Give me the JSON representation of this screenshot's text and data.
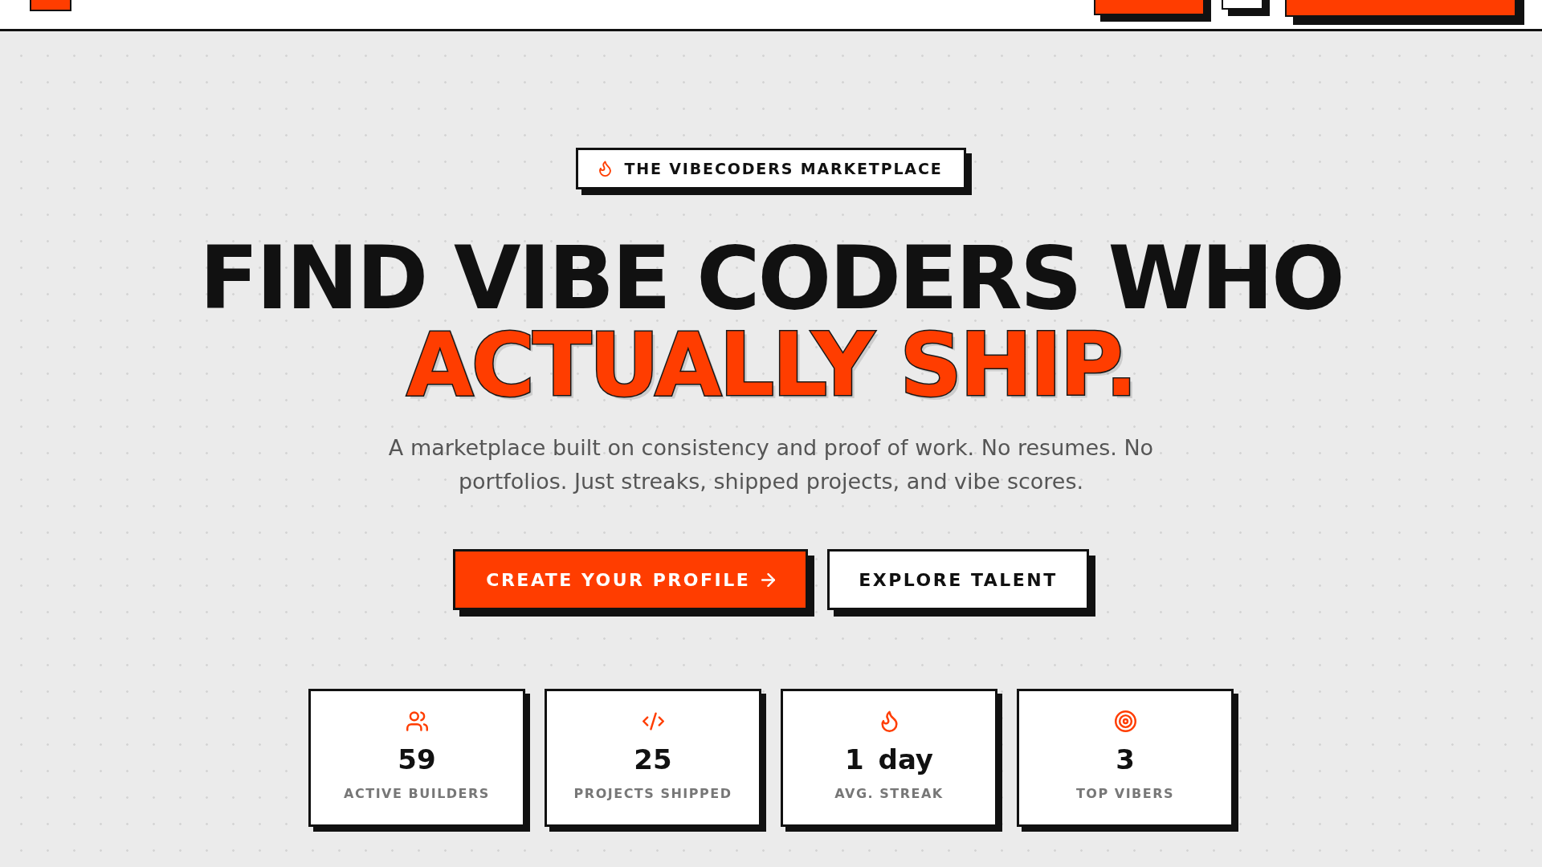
{
  "header": {
    "buttons": [
      {
        "kind": "primary"
      },
      {
        "kind": "secondary"
      },
      {
        "kind": "primary"
      }
    ]
  },
  "hero": {
    "badge": "THE VIBECODERS MARKETPLACE",
    "headline": "FIND VIBE CODERS WHO",
    "headline_accent": "ACTUALLY SHIP.",
    "description": "A marketplace built on consistency and proof of work. No resumes. No portfolios. Just streaks, shipped projects, and vibe scores.",
    "buttons": [
      {
        "label": "CREATE YOUR PROFILE",
        "kind": "primary"
      },
      {
        "label": "EXPLORE TALENT",
        "kind": "secondary"
      }
    ]
  },
  "stats": [
    {
      "value": "59",
      "label": "ACTIVE BUILDERS"
    },
    {
      "value": "25",
      "label": "PROJECTS SHIPPED"
    },
    {
      "value": "1 day",
      "label": "AVG. STREAK"
    },
    {
      "value": "3",
      "label": "TOP VIBERS"
    }
  ]
}
